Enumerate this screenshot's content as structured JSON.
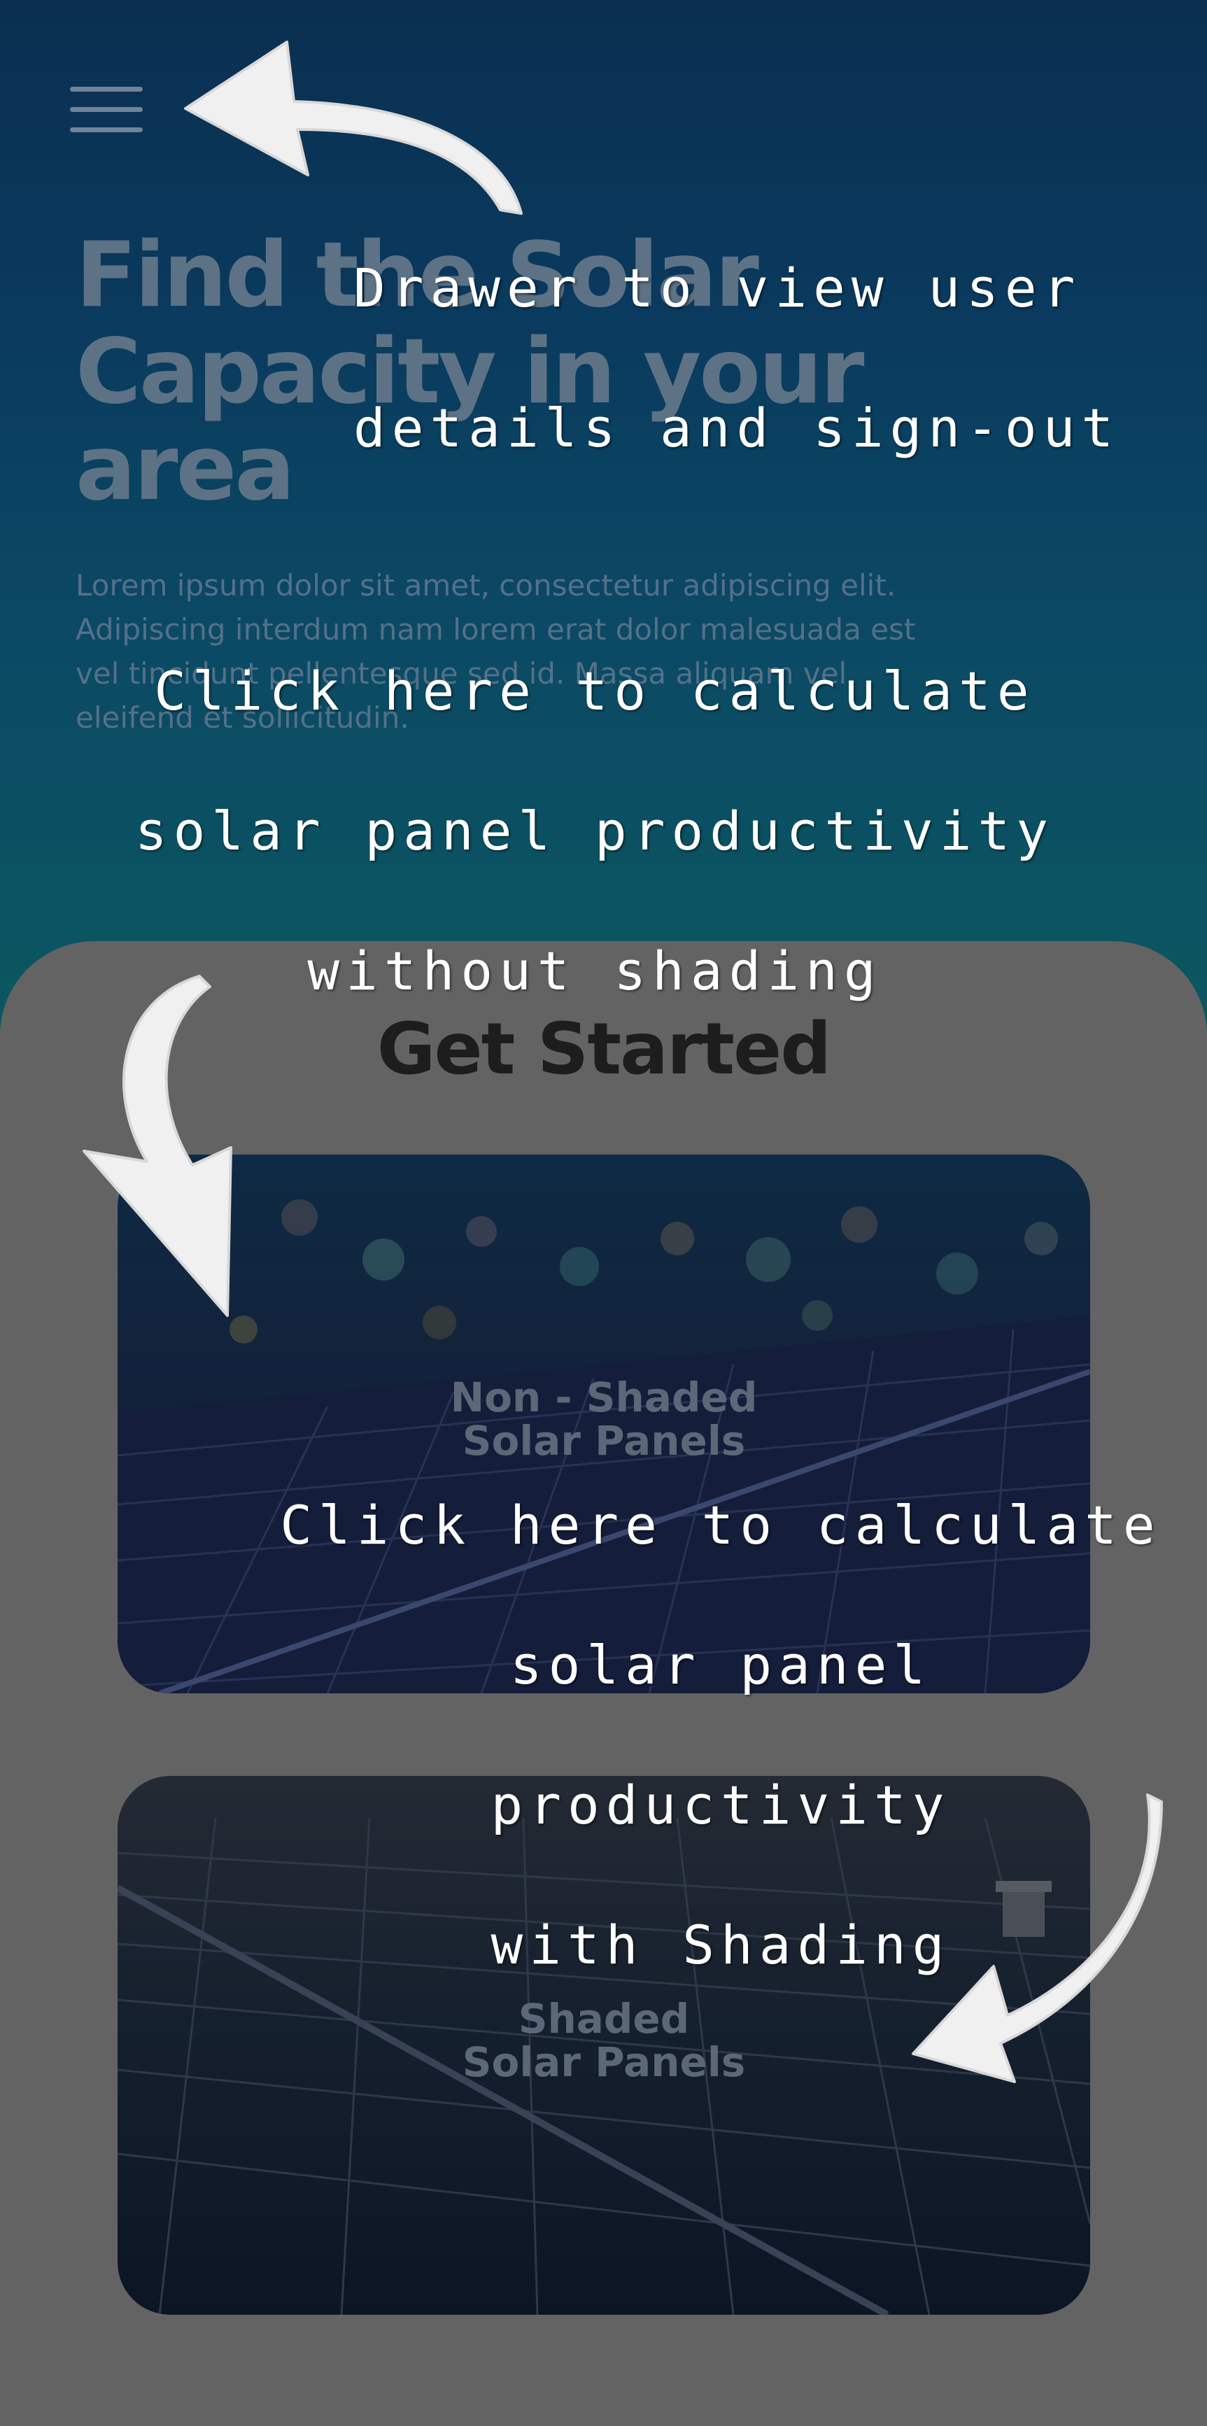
{
  "hero": {
    "title": "Find the Solar Capacity in your area",
    "description": "Lorem ipsum dolor sit amet, consectetur adipiscing elit. Adipiscing interdum nam lorem erat dolor malesuada est vel tincidunt pellentesque sed id. Massa aliquam vel eleifend et sollicitudin."
  },
  "menu": {
    "icon": "hamburger-menu-icon"
  },
  "main": {
    "heading": "Get Started",
    "cards": [
      {
        "label": "Non - Shaded\nSolar Panels"
      },
      {
        "label": "Shaded\nSolar Panels"
      }
    ]
  },
  "annotations": {
    "drawer": "Drawer to view user\ndetails and sign-out",
    "non_shaded": "Click here to calculate\nsolar panel productivity\nwithout shading",
    "shaded": "Click here to calculate\nsolar panel productivity\nwith Shading"
  },
  "colors": {
    "hero_top": "#0a2f50",
    "hero_bottom": "#0b5860",
    "panel": "#636363",
    "annotation": "#ffffff"
  }
}
